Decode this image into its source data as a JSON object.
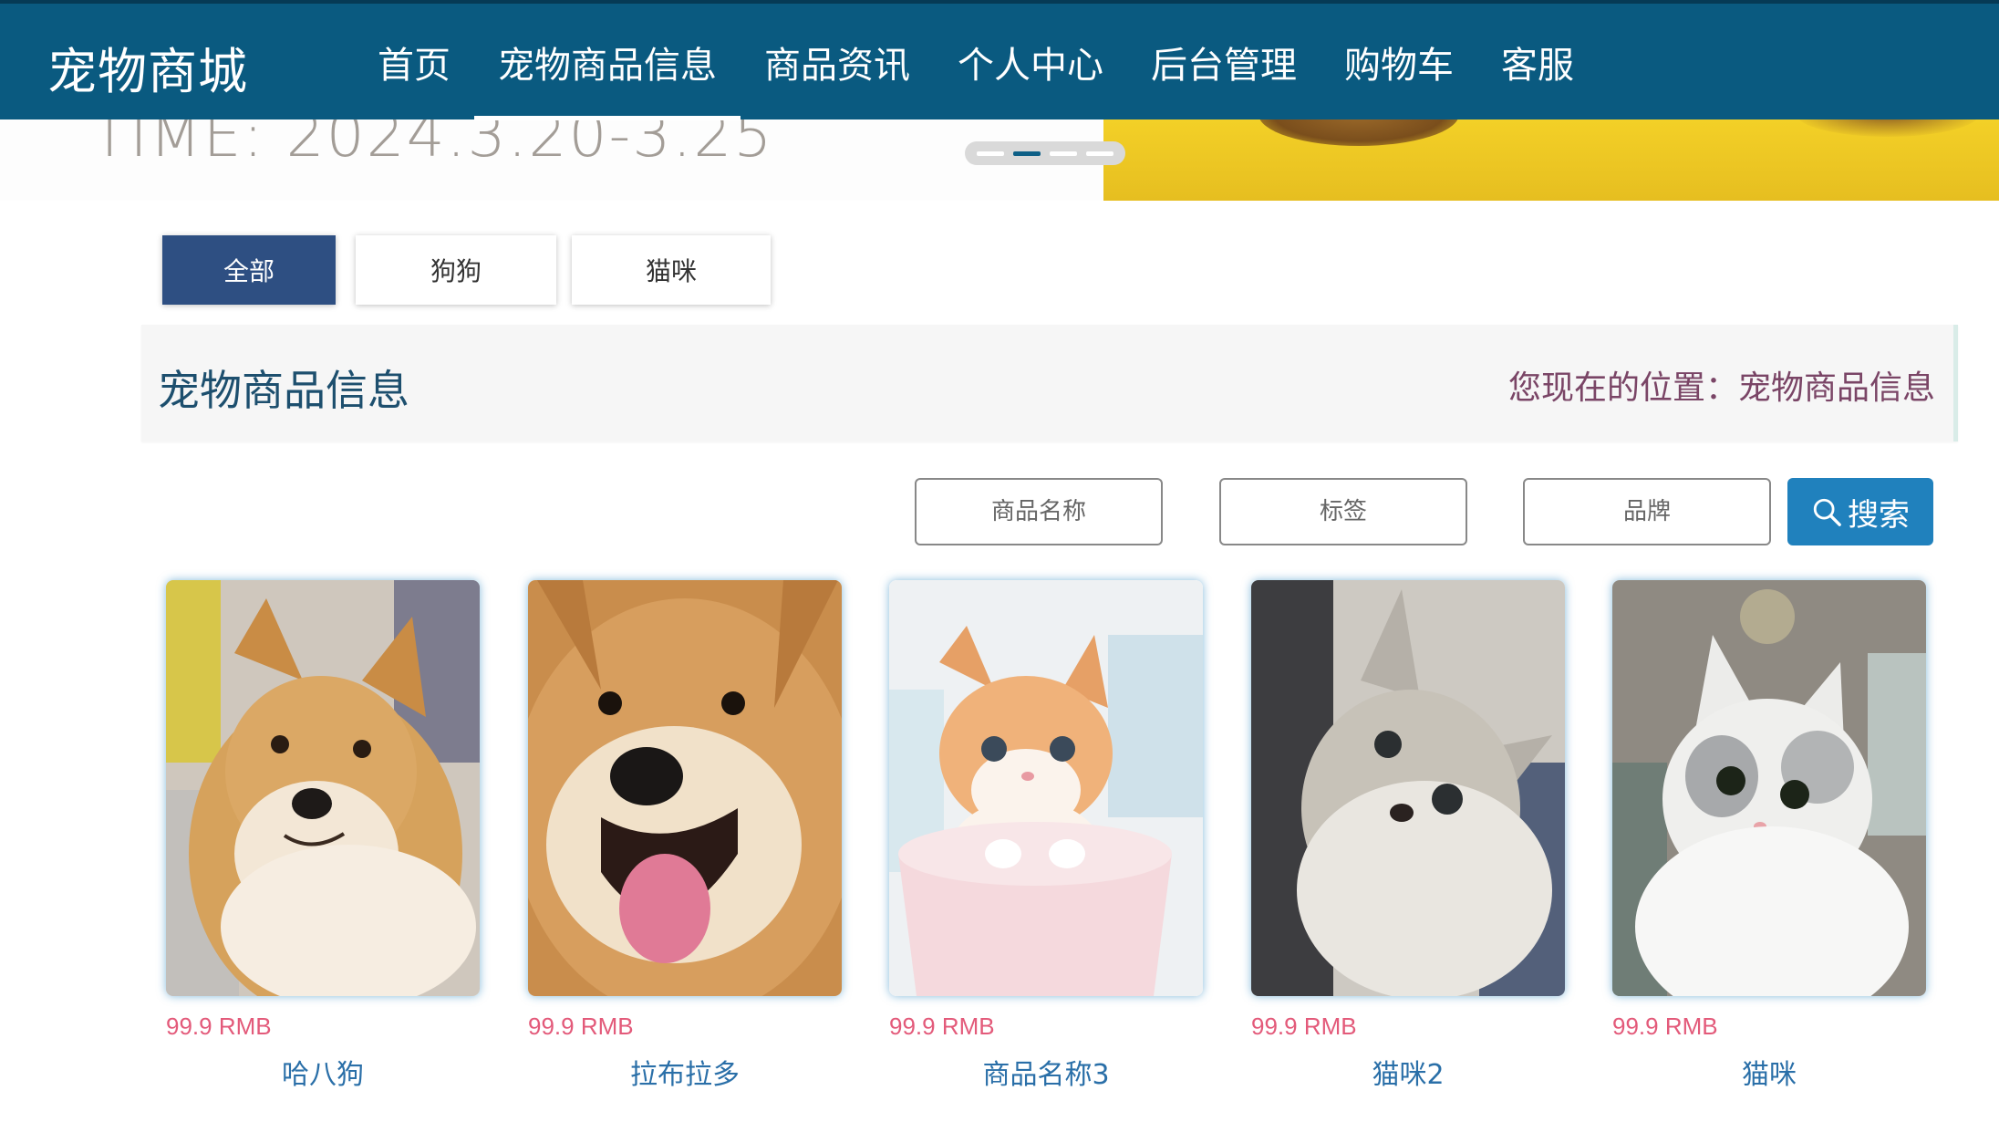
{
  "banner": {
    "time_text": "TIME: 2024.3.20-3.25",
    "slide_count": 4,
    "active_slide": 2
  },
  "navbar": {
    "logo": "宠物商城",
    "items": [
      "首页",
      "宠物商品信息",
      "商品资讯",
      "个人中心",
      "后台管理",
      "购物车",
      "客服"
    ],
    "active_index": 1,
    "bg_color": "#0a5a80"
  },
  "categories": {
    "items": [
      "全部",
      "狗狗",
      "猫咪"
    ],
    "active_index": 0,
    "active_color": "#2e4f82"
  },
  "title_bar": {
    "title": "宠物商品信息",
    "location": "您现在的位置：宠物商品信息"
  },
  "search": {
    "name_placeholder": "商品名称",
    "tag_placeholder": "标签",
    "brand_placeholder": "品牌",
    "button_label": "搜索",
    "button_color": "#2081bd"
  },
  "products": [
    {
      "price": "99.9 RMB",
      "name": "哈八狗",
      "image": "shiba-dog-photo"
    },
    {
      "price": "99.9 RMB",
      "name": "拉布拉多",
      "image": "shiba-dog-smiling-photo"
    },
    {
      "price": "99.9 RMB",
      "name": "商品名称3",
      "image": "orange-kitten-in-cup-photo"
    },
    {
      "price": "99.9 RMB",
      "name": "猫咪2",
      "image": "grey-kitten-photo"
    },
    {
      "price": "99.9 RMB",
      "name": "猫咪",
      "image": "white-cat-photo"
    }
  ],
  "colors": {
    "price": "#e35a7a",
    "product_name": "#2a6fa8"
  }
}
